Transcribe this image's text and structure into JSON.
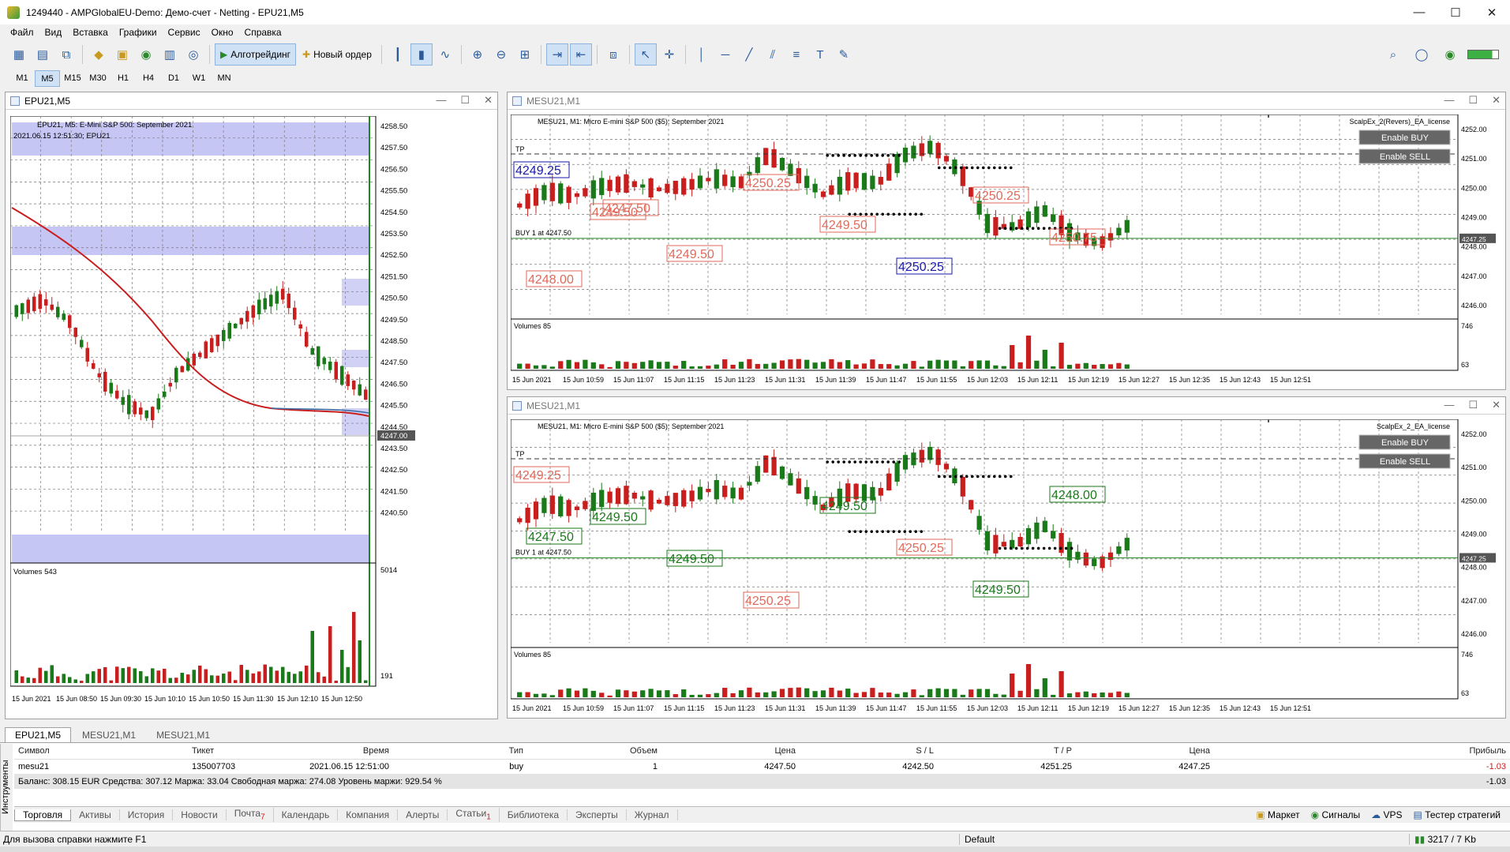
{
  "window": {
    "title": "1249440 - AMPGlobalEU-Demo: Демо-счет - Netting - EPU21,M5",
    "controls": [
      "—",
      "☐",
      "✕"
    ]
  },
  "menu": [
    "Файл",
    "Вид",
    "Вставка",
    "Графики",
    "Сервис",
    "Окно",
    "Справка"
  ],
  "toolbar": {
    "algo_label": "Алготрейдинг",
    "new_order_label": "Новый ордер"
  },
  "timeframes": [
    "M1",
    "M5",
    "M15",
    "M30",
    "H1",
    "H4",
    "D1",
    "W1",
    "MN"
  ],
  "active_timeframe": "M5",
  "charts": {
    "left": {
      "window_title": "EPU21,M5",
      "header": "EPU21, M5:  E-Mini S&P 500: September 2021",
      "sub_header": "2021.06.15 12:51:30; EPU21",
      "price_labels": [
        "4258.50",
        "4257.50",
        "4256.50",
        "4255.50",
        "4254.50",
        "4253.50",
        "4252.50",
        "4251.50",
        "4250.50",
        "4249.50",
        "4248.50",
        "4247.50",
        "4246.50",
        "4245.50",
        "4244.50",
        "4243.50",
        "4242.50",
        "4241.50",
        "4240.50"
      ],
      "current_price": "4247.00",
      "volume_label": "Volumes 543",
      "volume_max": "5014",
      "volume_min": "191",
      "time_labels": [
        "15 Jun 2021",
        "15 Jun 08:50",
        "15 Jun 09:30",
        "15 Jun 10:10",
        "15 Jun 10:50",
        "15 Jun 11:30",
        "15 Jun 12:10",
        "15 Jun 12:50"
      ]
    },
    "right_top": {
      "window_title": "MESU21,M1",
      "header": "MESU21, M1:  Micro E-mini S&P 500 ($5): September 2021",
      "ea_label": "ScalpEx_2(Revers)_EA_license",
      "buttons": [
        "Enable BUY",
        "Enable SELL"
      ],
      "tp_label": "TP",
      "buy_label": "BUY 1 at 4247.50",
      "price_labels": [
        "4252.00",
        "4251.00",
        "4250.00",
        "4249.00",
        "4248.00",
        "4247.00",
        "4246.00"
      ],
      "current_price": "4247.25",
      "volume_label": "Volumes 85",
      "volume_max": "746",
      "volume_min": "63",
      "level_boxes": [
        "4249.25",
        "4249.50",
        "4249.50",
        "4250.25",
        "4249.50",
        "4250.25",
        "4250.25",
        "4250.75",
        "4248.00",
        "4247.50"
      ],
      "time_labels": [
        "15 Jun 2021",
        "15 Jun 10:59",
        "15 Jun 11:07",
        "15 Jun 11:15",
        "15 Jun 11:23",
        "15 Jun 11:31",
        "15 Jun 11:39",
        "15 Jun 11:47",
        "15 Jun 11:55",
        "15 Jun 12:03",
        "15 Jun 12:11",
        "15 Jun 12:19",
        "15 Jun 12:27",
        "15 Jun 12:35",
        "15 Jun 12:43",
        "15 Jun 12:51"
      ]
    },
    "right_bottom": {
      "window_title": "MESU21,M1",
      "header": "MESU21, M1:  Micro E-mini S&P 500 ($5): September 2021",
      "ea_label": "ScalpEx_2_EA_license",
      "buttons": [
        "Enable BUY",
        "Enable SELL"
      ],
      "tp_label": "TP",
      "buy_label": "BUY 1 at 4247.50",
      "price_labels": [
        "4252.00",
        "4251.00",
        "4250.00",
        "4249.00",
        "4248.00",
        "4247.00",
        "4246.00"
      ],
      "current_price": "4247.25",
      "volume_label": "Volumes 85",
      "volume_max": "746",
      "volume_min": "63",
      "level_boxes": [
        "4249.25",
        "4249.50",
        "4249.50",
        "4250.25",
        "4249.50",
        "4250.25",
        "4249.50",
        "4248.00",
        "4247.50"
      ],
      "time_labels": [
        "15 Jun 2021",
        "15 Jun 10:59",
        "15 Jun 11:07",
        "15 Jun 11:15",
        "15 Jun 11:23",
        "15 Jun 11:31",
        "15 Jun 11:39",
        "15 Jun 11:47",
        "15 Jun 11:55",
        "15 Jun 12:03",
        "15 Jun 12:11",
        "15 Jun 12:19",
        "15 Jun 12:27",
        "15 Jun 12:35",
        "15 Jun 12:43",
        "15 Jun 12:51"
      ]
    }
  },
  "chart_tabs": [
    "EPU21,M5",
    "MESU21,M1",
    "MESU21,M1"
  ],
  "toolbox_title": "Инструменты",
  "trades": {
    "headers": [
      "Символ",
      "Тикет",
      "Время",
      "Тип",
      "Объем",
      "Цена",
      "S / L",
      "T / P",
      "Цена",
      "Прибыль"
    ],
    "rows": [
      {
        "symbol": "mesu21",
        "ticket": "135007703",
        "time": "2021.06.15 12:51:00",
        "type": "buy",
        "volume": "1",
        "price": "4247.50",
        "sl": "4242.50",
        "tp": "4251.25",
        "cur": "4247.25",
        "profit": "-1.03"
      }
    ],
    "balance": "Баланс: 308.15 EUR  Средства: 307.12  Маржа: 33.04  Свободная маржа: 274.08  Уровень маржи: 929.54 %",
    "total_profit": "-1.03"
  },
  "bottom_tabs": [
    "Торговля",
    "Активы",
    "История",
    "Новости",
    "Почта",
    "Календарь",
    "Компания",
    "Алерты",
    "Статьи",
    "Библиотека",
    "Эксперты",
    "Журнал"
  ],
  "mail_badge": "7",
  "articles_badge": "1",
  "right_links": [
    "Маркет",
    "Сигналы",
    "VPS",
    "Тестер стратегий"
  ],
  "status": {
    "help": "Для вызова справки нажмите F1",
    "profile": "Default",
    "traffic": "3217 / 7 Kb"
  },
  "colors": {
    "bull": "#1a7a1a",
    "bear": "#c81e1e",
    "zone": "#b3b3f0",
    "ma": "#c81e1e"
  }
}
